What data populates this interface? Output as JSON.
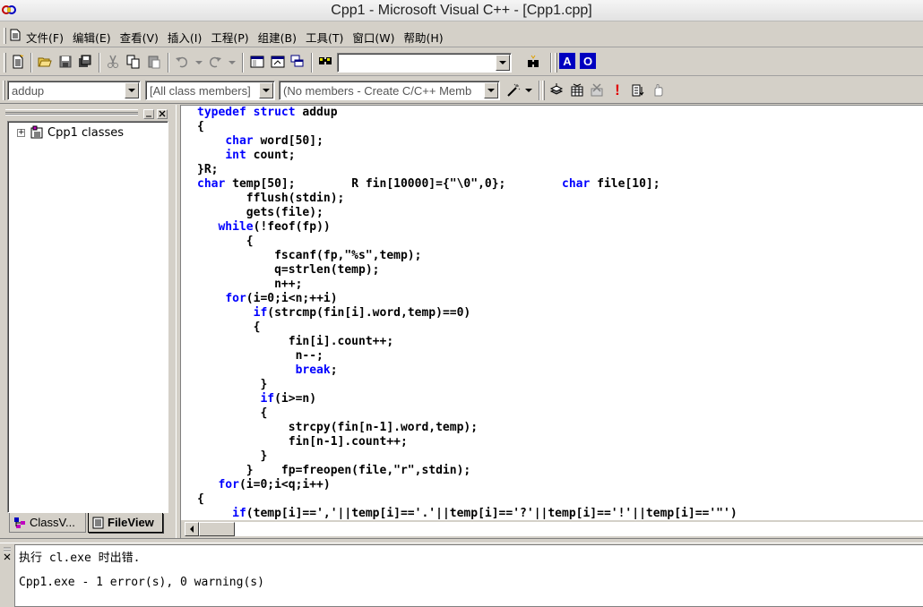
{
  "window": {
    "title": "Cpp1 - Microsoft Visual C++ - [Cpp1.cpp]",
    "app_icon": "vc-infinity-icon"
  },
  "menu": {
    "items": [
      {
        "label": "文件(F)"
      },
      {
        "label": "编辑(E)"
      },
      {
        "label": "查看(V)"
      },
      {
        "label": "插入(I)"
      },
      {
        "label": "工程(P)"
      },
      {
        "label": "组建(B)"
      },
      {
        "label": "工具(T)"
      },
      {
        "label": "窗口(W)"
      },
      {
        "label": "帮助(H)"
      }
    ]
  },
  "toolbar1": {
    "find_combo_value": "",
    "icons": [
      "new-text-file-icon",
      "open-folder-icon",
      "save-icon",
      "save-all-icon",
      "cut-icon",
      "copy-icon",
      "paste-icon",
      "undo-icon",
      "redo-icon",
      "workspace-icon",
      "output-icon",
      "window-list-icon",
      "find-in-files-icon",
      "find-icon",
      "a-blue-icon",
      "o-blue-icon"
    ]
  },
  "toolbar2": {
    "scope_combo_value": "addup",
    "class_combo_value": "[All class members]",
    "members_combo_value": "(No members - Create C/C++ Memb",
    "icons": [
      "wizard-icon",
      "compile-icon",
      "build-icon",
      "stop-build-icon",
      "execute-icon",
      "go-icon",
      "breakpoint-icon"
    ]
  },
  "workspace": {
    "tree_root": "Cpp1 classes",
    "tabs": [
      {
        "label": "ClassV..."
      },
      {
        "label": "FileView"
      }
    ]
  },
  "editor": {
    "lines": [
      [
        {
          "t": "typedef struct",
          "kw": true
        },
        {
          "t": " addup"
        }
      ],
      [
        {
          "t": "{"
        }
      ],
      [
        {
          "t": "    "
        },
        {
          "t": "char",
          "kw": true
        },
        {
          "t": " word[50];"
        }
      ],
      [
        {
          "t": "    "
        },
        {
          "t": "int",
          "kw": true
        },
        {
          "t": " count;"
        }
      ],
      [
        {
          "t": "}R;"
        }
      ],
      [
        {
          "t": "char",
          "kw": true
        },
        {
          "t": " temp[50];        R fin[10000]={\"\\0\",0};        "
        },
        {
          "t": "char",
          "kw": true
        },
        {
          "t": " file[10];"
        }
      ],
      [
        {
          "t": "       fflush(stdin);"
        }
      ],
      [
        {
          "t": "       gets(file);"
        }
      ],
      [
        {
          "t": "   "
        },
        {
          "t": "while",
          "kw": true
        },
        {
          "t": "(!feof(fp))"
        }
      ],
      [
        {
          "t": "       {"
        }
      ],
      [
        {
          "t": "           fscanf(fp,\"%s\",temp);"
        }
      ],
      [
        {
          "t": "           q=strlen(temp);"
        }
      ],
      [
        {
          "t": "           n++;"
        }
      ],
      [
        {
          "t": "    "
        },
        {
          "t": "for",
          "kw": true
        },
        {
          "t": "(i=0;i<n;++i)"
        }
      ],
      [
        {
          "t": "        "
        },
        {
          "t": "if",
          "kw": true
        },
        {
          "t": "(strcmp(fin[i].word,temp)==0)"
        }
      ],
      [
        {
          "t": "        {"
        }
      ],
      [
        {
          "t": "             fin[i].count++;"
        }
      ],
      [
        {
          "t": "              n--;"
        }
      ],
      [
        {
          "t": "              "
        },
        {
          "t": "break",
          "kw": true
        },
        {
          "t": ";"
        }
      ],
      [
        {
          "t": "         }"
        }
      ],
      [
        {
          "t": "         "
        },
        {
          "t": "if",
          "kw": true
        },
        {
          "t": "(i>=n)"
        }
      ],
      [
        {
          "t": "         {"
        }
      ],
      [
        {
          "t": "             strcpy(fin[n-1].word,temp);"
        }
      ],
      [
        {
          "t": "             fin[n-1].count++;"
        }
      ],
      [
        {
          "t": "         }"
        }
      ],
      [
        {
          "t": "       }    fp=freopen(file,\"r\",stdin);"
        }
      ],
      [
        {
          "t": "   "
        },
        {
          "t": "for",
          "kw": true
        },
        {
          "t": "(i=0;i<q;i++)"
        }
      ],
      [
        {
          "t": "{"
        }
      ],
      [
        {
          "t": "     "
        },
        {
          "t": "if",
          "kw": true
        },
        {
          "t": "(temp[i]==','||temp[i]=='.'||temp[i]=='?'||temp[i]=='!'||temp[i]=='\"')"
        }
      ]
    ]
  },
  "output": {
    "line1": "执行 cl.exe 时出错.",
    "line2": "Cpp1.exe - 1 error(s), 0 warning(s)"
  },
  "colors": {
    "keyword": "#0000ff",
    "chrome": "#d4d0c8"
  }
}
